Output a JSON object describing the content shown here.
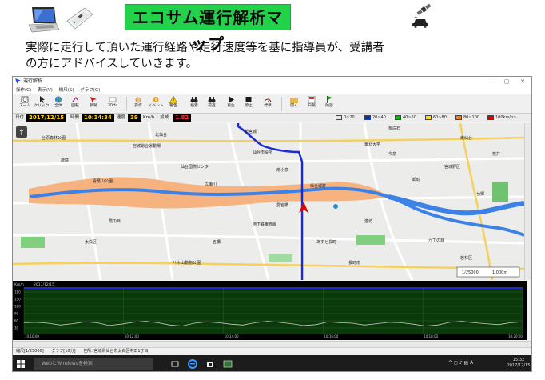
{
  "banner": {
    "title": "エコサム運行解析マップ",
    "description_line1": "実際に走行して頂いた運行経路や走行速度等を基に指導員が、受講者",
    "description_line2": "の方にアドバイスしていきます。"
  },
  "window": {
    "title": "運行解析",
    "menu": [
      "操作(C)",
      "表示(V)",
      "機尺(S)",
      "グラフ(G)"
    ],
    "toolbar": [
      {
        "label": "ズーム",
        "icon": "zoom-icon"
      },
      {
        "label": "クリック",
        "icon": "cursor-icon"
      },
      {
        "label": "全体",
        "icon": "globe-icon"
      },
      {
        "label": "回転",
        "icon": "rotate-icon"
      },
      {
        "label": "軌跡",
        "icon": "track-icon"
      },
      {
        "label": "30Hz",
        "icon": "rate-icon"
      },
      {
        "label": "操作",
        "icon": "hand-icon"
      },
      {
        "label": "イベント",
        "icon": "event-icon"
      },
      {
        "label": "警告",
        "icon": "warning-icon"
      },
      {
        "label": "検索",
        "icon": "binoculars-icon"
      },
      {
        "label": "前進",
        "icon": "binoculars-icon"
      },
      {
        "label": "再生",
        "icon": "play-icon"
      },
      {
        "label": "停止",
        "icon": "stop-icon"
      },
      {
        "label": "標準",
        "icon": "speed-icon"
      },
      {
        "label": "開く",
        "icon": "open-icon"
      },
      {
        "label": "日報",
        "icon": "report-icon"
      },
      {
        "label": "防犯",
        "icon": "flag-icon"
      }
    ],
    "info": {
      "date_label": "日付",
      "date": "2017/12/15",
      "time_label": "時間",
      "time": "10:14:34",
      "speed_label": "速度",
      "speed": "39",
      "speed_unit": "Km/h",
      "accel_label": "加減",
      "accel": "1.82"
    },
    "legend": [
      {
        "label": "0~20",
        "color": "#e8e8e8"
      },
      {
        "label": "20~40",
        "color": "#0033cc"
      },
      {
        "label": "40~60",
        "color": "#00c000"
      },
      {
        "label": "60~80",
        "color": "#ffe000"
      },
      {
        "label": "80~100",
        "color": "#ff8000"
      },
      {
        "label": "100km/h~",
        "color": "#e00000"
      }
    ],
    "map": {
      "scale_text": "1/25000",
      "scale_distance": "1,000m",
      "labels": [
        "新宮城",
        "台原森林公園",
        "仙台市役所",
        "東北大学",
        "仙台城跡",
        "宮城野区",
        "太白区",
        "北仙台",
        "東仙台",
        "青葉山公園",
        "広瀬川",
        "茂庭",
        "根白石",
        "あすと長町",
        "六丁の目",
        "宮城総合運動場",
        "仙台国際センター",
        "愛宕橋",
        "八木山動物公園",
        "長町南",
        "地下鉄東西線",
        "五橋",
        "連坊",
        "荒井",
        "卸町",
        "若林区",
        "今泉",
        "七郷",
        "霞の目",
        "南小泉"
      ]
    },
    "graph": {
      "ylabel": "Km/h",
      "date": "2017/12/15",
      "y_ticks": [
        "180",
        "150",
        "120",
        "90",
        "60",
        "30"
      ],
      "x_ticks": [
        "10:10:00",
        "10:12:00",
        "10:14:00",
        "10:16:00",
        "10:18:00",
        "10:20:00"
      ]
    },
    "status": [
      "縮尺[1/25000]",
      "グラフ[10分]",
      "住所: 宮城県仙台市太白区中田1丁目"
    ],
    "taskbar": {
      "search_placeholder": "WebとWindowsを検索",
      "time": "15:32",
      "date": "2017/12/15",
      "ime": "A"
    }
  },
  "colors": {
    "title_bg": "#22d24a",
    "route": "#1a2bd6",
    "river": "#3c82e6",
    "floodplain": "#f6b27f",
    "graph_bg": "#0a3a0a",
    "graph_line": "#c8c8c8"
  }
}
